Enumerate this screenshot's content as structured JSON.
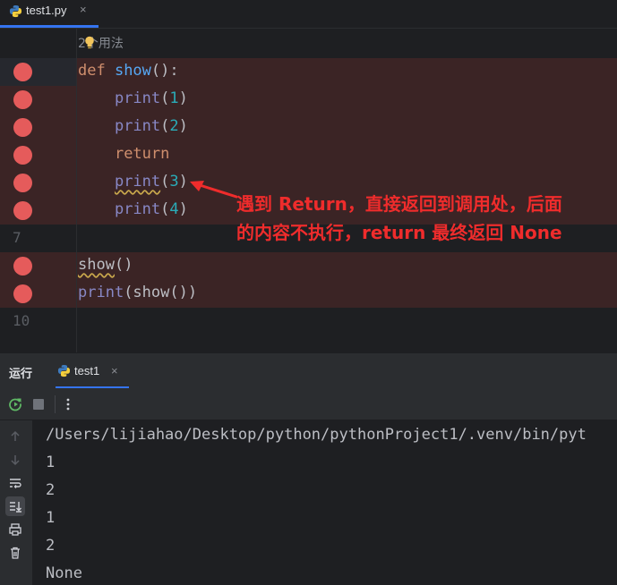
{
  "editor_tab": {
    "filename": "test1.py",
    "close": "×"
  },
  "editor": {
    "usages_hint": "2个用法",
    "lines": [
      {
        "n": "",
        "tokens": [
          [
            "kw",
            "def "
          ],
          [
            "fn",
            "show"
          ],
          [
            "plain",
            "():"
          ]
        ]
      },
      {
        "n": "",
        "tokens": [
          [
            "plain",
            "    "
          ],
          [
            "bi",
            "print"
          ],
          [
            "plain",
            "("
          ],
          [
            "num",
            "1"
          ],
          [
            "plain",
            ")"
          ]
        ]
      },
      {
        "n": "",
        "tokens": [
          [
            "plain",
            "    "
          ],
          [
            "bi",
            "print"
          ],
          [
            "plain",
            "("
          ],
          [
            "num",
            "2"
          ],
          [
            "plain",
            ")"
          ]
        ]
      },
      {
        "n": "",
        "tokens": [
          [
            "plain",
            "    "
          ],
          [
            "kw",
            "return"
          ]
        ]
      },
      {
        "n": "",
        "tokens": [
          [
            "plain",
            "    "
          ],
          [
            "bi squig",
            "print"
          ],
          [
            "plain",
            "("
          ],
          [
            "num",
            "3"
          ],
          [
            "plain",
            ")"
          ]
        ]
      },
      {
        "n": "",
        "tokens": [
          [
            "plain",
            "    "
          ],
          [
            "bi",
            "print"
          ],
          [
            "plain",
            "("
          ],
          [
            "num",
            "4"
          ],
          [
            "plain",
            ")"
          ]
        ]
      },
      {
        "n": "7",
        "tokens": []
      },
      {
        "n": "",
        "tokens": [
          [
            "plain squig",
            "show"
          ],
          [
            "plain",
            "()"
          ]
        ]
      },
      {
        "n": "",
        "tokens": [
          [
            "bi",
            "print"
          ],
          [
            "plain",
            "(show())"
          ]
        ]
      },
      {
        "n": "10",
        "tokens": []
      }
    ],
    "annotation_line1": "遇到 Return，直接返回到调用处，后面",
    "annotation_line2": "的内容不执行，return 最终返回 None"
  },
  "run_panel": {
    "title": "运行",
    "tab_label": "test1",
    "tab_close": "×",
    "output": [
      "/Users/lijiahao/Desktop/python/pythonProject1/.venv/bin/pyt",
      "1",
      "2",
      "1",
      "2",
      "None"
    ]
  },
  "colors": {
    "breakpoint": "#e55b5b",
    "annotation": "#ef2c2c",
    "accent": "#3574f0"
  }
}
